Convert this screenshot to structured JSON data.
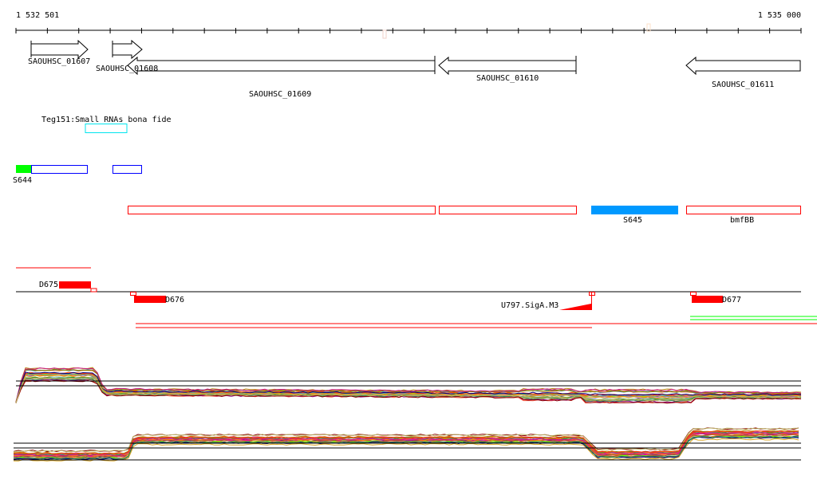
{
  "ruler": {
    "start_label": "1 532 501",
    "end_label": "1 535 000",
    "tick_count": 26
  },
  "genes": [
    {
      "label": "SAOUHSC_01607",
      "strand": "+"
    },
    {
      "label": "SAOUHSC_01608",
      "strand": "+"
    },
    {
      "label": "SAOUHSC_01609",
      "strand": "-"
    },
    {
      "label": "SAOUHSC_01610",
      "strand": "-"
    },
    {
      "label": "SAOUHSC_01611",
      "strand": "-"
    }
  ],
  "small_rna": {
    "label": "Teg151:Small RNAs bona fide",
    "color": "#00e5ee"
  },
  "features": {
    "s644": "S644",
    "s645": "S645",
    "bmfbb": "bmfBB",
    "d675": "D675",
    "d676": "D676",
    "d677": "D677",
    "u797": "U797.SigA.M3"
  },
  "colors": {
    "red": "#ff0000",
    "blue": "#0000ff",
    "green": "#00ff00",
    "sky": "#0099ff"
  },
  "trace_colors": [
    "#b8860b",
    "#ff6347",
    "#9acd32",
    "#8b008b",
    "#4682b4",
    "#d2691e",
    "#228b22",
    "#ff1493",
    "#87ceeb",
    "#a0522d",
    "#808000",
    "#dc143c",
    "#7cfc00",
    "#ba55d3",
    "#ff8c00",
    "#6b8e23",
    "#c71585",
    "#5f9ea0",
    "#cd853f",
    "#ff4500",
    "#000080",
    "#2e8b57",
    "#daa520",
    "#8b0000",
    "#bdb76b"
  ]
}
